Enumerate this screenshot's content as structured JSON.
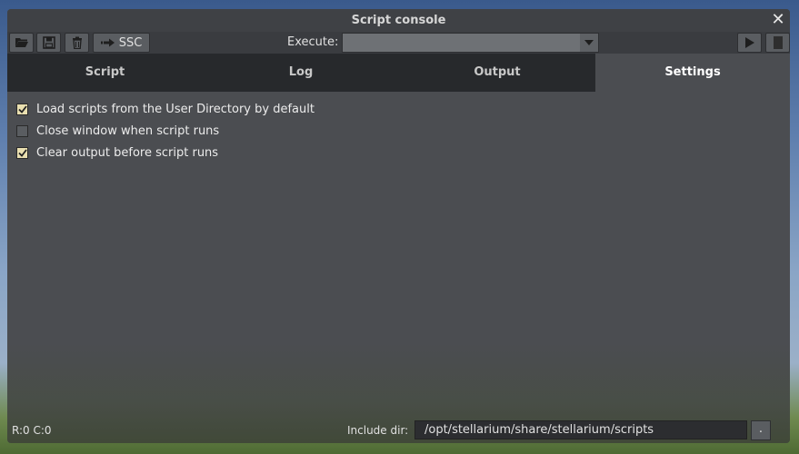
{
  "window": {
    "title": "Script console"
  },
  "toolbar": {
    "ssc_label": "SSC",
    "execute_label": "Execute:",
    "execute_value": ""
  },
  "tabs": [
    {
      "label": "Script",
      "active": false
    },
    {
      "label": "Log",
      "active": false
    },
    {
      "label": "Output",
      "active": false
    },
    {
      "label": "Settings",
      "active": true
    }
  ],
  "settings": {
    "options": [
      {
        "label": "Load scripts from the User Directory by default",
        "checked": true
      },
      {
        "label": "Close window when script runs",
        "checked": false
      },
      {
        "label": "Clear output before script runs",
        "checked": true
      }
    ]
  },
  "footer": {
    "status": "R:0 C:0",
    "include_dir_label": "Include dir:",
    "include_dir_value": "/opt/stellarium/share/stellarium/scripts",
    "browse_label": "."
  }
}
